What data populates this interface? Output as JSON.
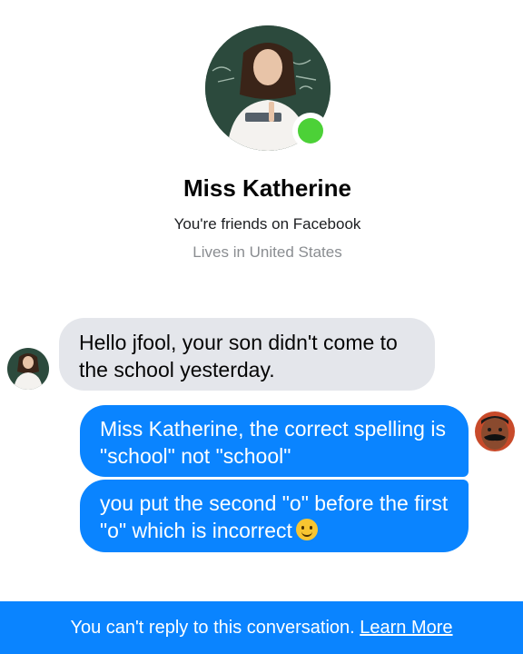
{
  "profile": {
    "name": "Miss Katherine",
    "friends_text": "You're friends on Facebook",
    "location_text": "Lives in United States",
    "online": true
  },
  "messages": [
    {
      "sender": "contact",
      "text": "Hello jfool, your son didn't come to the school yesterday."
    },
    {
      "sender": "me",
      "text": "Miss Katherine, the correct spelling is \"school\" not \"school\""
    },
    {
      "sender": "me",
      "text": "you put the second \"o\" before the first \"o\" which is incorrect",
      "emoji": "slightly-smiling-face"
    }
  ],
  "footer": {
    "notice": "You can't reply to this conversation.",
    "link_label": "Learn More"
  },
  "colors": {
    "accent": "#0a84ff",
    "incoming_bubble": "#e4e6eb",
    "online_dot": "#4cd137"
  }
}
